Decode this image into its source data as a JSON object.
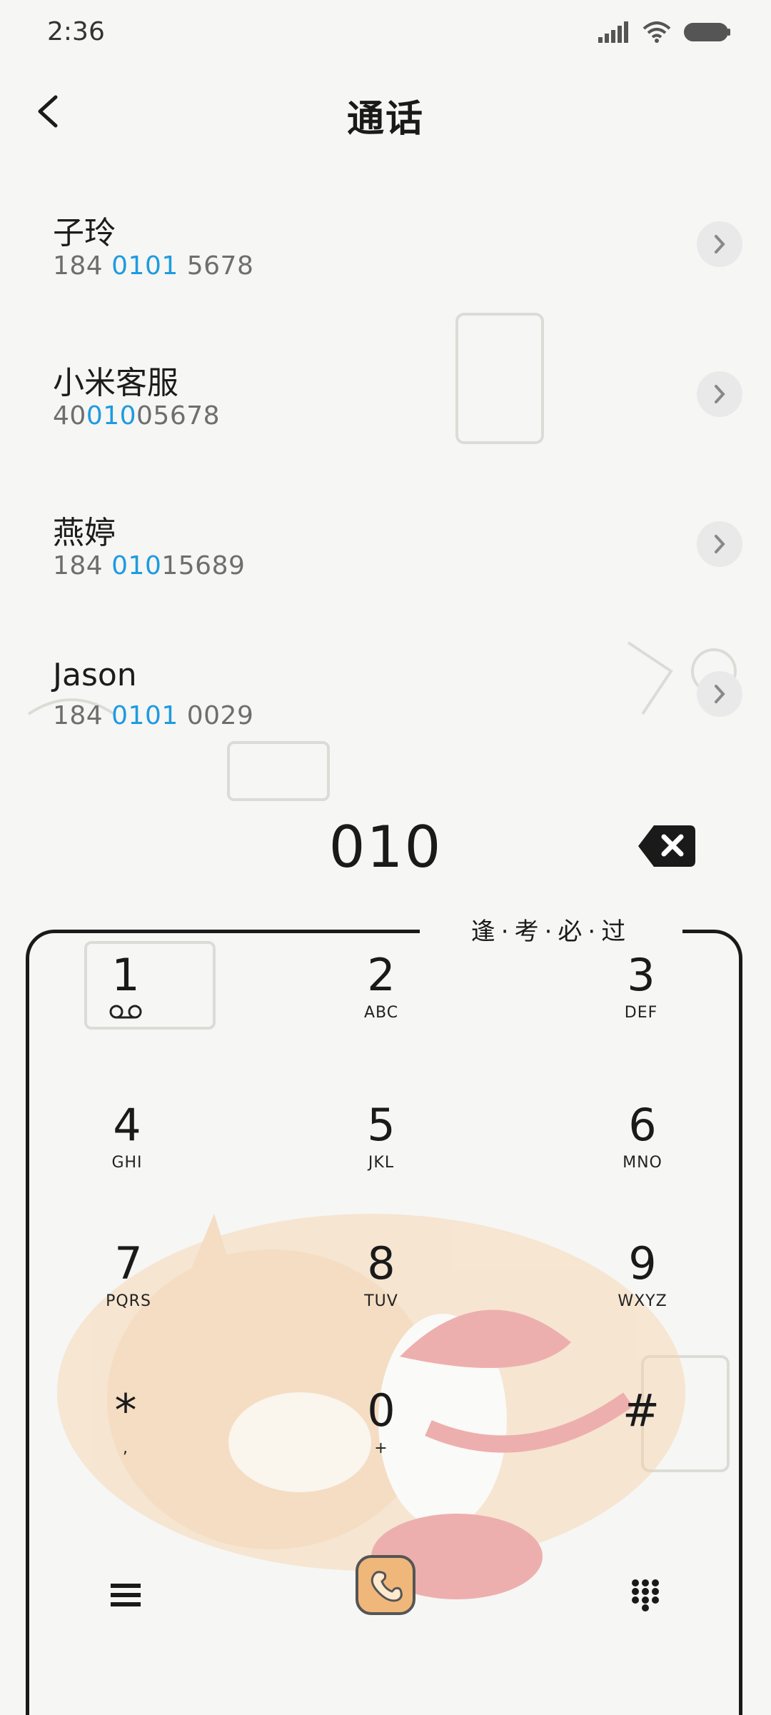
{
  "status_bar": {
    "time": "2:36"
  },
  "header": {
    "title": "通话"
  },
  "contacts": [
    {
      "name": "子玲",
      "number_parts": [
        "184 ",
        "0101",
        " 5678"
      ]
    },
    {
      "name": "小米客服",
      "number_parts": [
        "40",
        "010",
        "05678"
      ]
    },
    {
      "name": "燕婷",
      "number_parts": [
        "184 ",
        "010",
        "15689"
      ]
    },
    {
      "name": "Jason",
      "number_parts": [
        "184 ",
        "0101",
        " 0029"
      ]
    }
  ],
  "dialer": {
    "input": "010",
    "slogan": "逢·考·必·过",
    "keys": [
      {
        "digit": "1",
        "letters": ""
      },
      {
        "digit": "2",
        "letters": "ABC"
      },
      {
        "digit": "3",
        "letters": "DEF"
      },
      {
        "digit": "4",
        "letters": "GHI"
      },
      {
        "digit": "5",
        "letters": "JKL"
      },
      {
        "digit": "6",
        "letters": "MNO"
      },
      {
        "digit": "7",
        "letters": "PQRS"
      },
      {
        "digit": "8",
        "letters": "TUV"
      },
      {
        "digit": "9",
        "letters": "WXYZ"
      },
      {
        "digit": "*",
        "letters": ","
      },
      {
        "digit": "0",
        "letters": "+"
      },
      {
        "digit": "#",
        "letters": ""
      }
    ]
  },
  "colors": {
    "highlight": "#1e9be0",
    "call_button": "#f0b77a"
  },
  "icons": {
    "back": "back-arrow-icon",
    "detail": "chevron-right-icon",
    "backspace": "backspace-icon",
    "voicemail": "voicemail-icon",
    "menu": "menu-icon",
    "call": "phone-call-icon",
    "keypad": "keypad-grid-icon"
  }
}
